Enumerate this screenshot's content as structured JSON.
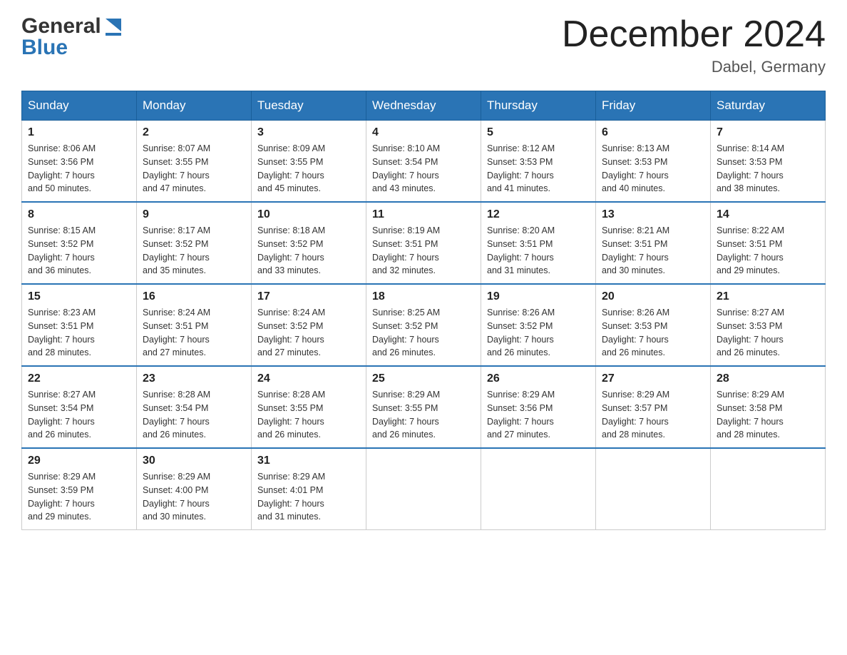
{
  "header": {
    "logo_general": "General",
    "logo_blue": "Blue",
    "month_title": "December 2024",
    "location": "Dabel, Germany"
  },
  "days_of_week": [
    "Sunday",
    "Monday",
    "Tuesday",
    "Wednesday",
    "Thursday",
    "Friday",
    "Saturday"
  ],
  "weeks": [
    [
      {
        "day": "1",
        "sunrise": "8:06 AM",
        "sunset": "3:56 PM",
        "daylight": "7 hours and 50 minutes."
      },
      {
        "day": "2",
        "sunrise": "8:07 AM",
        "sunset": "3:55 PM",
        "daylight": "7 hours and 47 minutes."
      },
      {
        "day": "3",
        "sunrise": "8:09 AM",
        "sunset": "3:55 PM",
        "daylight": "7 hours and 45 minutes."
      },
      {
        "day": "4",
        "sunrise": "8:10 AM",
        "sunset": "3:54 PM",
        "daylight": "7 hours and 43 minutes."
      },
      {
        "day": "5",
        "sunrise": "8:12 AM",
        "sunset": "3:53 PM",
        "daylight": "7 hours and 41 minutes."
      },
      {
        "day": "6",
        "sunrise": "8:13 AM",
        "sunset": "3:53 PM",
        "daylight": "7 hours and 40 minutes."
      },
      {
        "day": "7",
        "sunrise": "8:14 AM",
        "sunset": "3:53 PM",
        "daylight": "7 hours and 38 minutes."
      }
    ],
    [
      {
        "day": "8",
        "sunrise": "8:15 AM",
        "sunset": "3:52 PM",
        "daylight": "7 hours and 36 minutes."
      },
      {
        "day": "9",
        "sunrise": "8:17 AM",
        "sunset": "3:52 PM",
        "daylight": "7 hours and 35 minutes."
      },
      {
        "day": "10",
        "sunrise": "8:18 AM",
        "sunset": "3:52 PM",
        "daylight": "7 hours and 33 minutes."
      },
      {
        "day": "11",
        "sunrise": "8:19 AM",
        "sunset": "3:51 PM",
        "daylight": "7 hours and 32 minutes."
      },
      {
        "day": "12",
        "sunrise": "8:20 AM",
        "sunset": "3:51 PM",
        "daylight": "7 hours and 31 minutes."
      },
      {
        "day": "13",
        "sunrise": "8:21 AM",
        "sunset": "3:51 PM",
        "daylight": "7 hours and 30 minutes."
      },
      {
        "day": "14",
        "sunrise": "8:22 AM",
        "sunset": "3:51 PM",
        "daylight": "7 hours and 29 minutes."
      }
    ],
    [
      {
        "day": "15",
        "sunrise": "8:23 AM",
        "sunset": "3:51 PM",
        "daylight": "7 hours and 28 minutes."
      },
      {
        "day": "16",
        "sunrise": "8:24 AM",
        "sunset": "3:51 PM",
        "daylight": "7 hours and 27 minutes."
      },
      {
        "day": "17",
        "sunrise": "8:24 AM",
        "sunset": "3:52 PM",
        "daylight": "7 hours and 27 minutes."
      },
      {
        "day": "18",
        "sunrise": "8:25 AM",
        "sunset": "3:52 PM",
        "daylight": "7 hours and 26 minutes."
      },
      {
        "day": "19",
        "sunrise": "8:26 AM",
        "sunset": "3:52 PM",
        "daylight": "7 hours and 26 minutes."
      },
      {
        "day": "20",
        "sunrise": "8:26 AM",
        "sunset": "3:53 PM",
        "daylight": "7 hours and 26 minutes."
      },
      {
        "day": "21",
        "sunrise": "8:27 AM",
        "sunset": "3:53 PM",
        "daylight": "7 hours and 26 minutes."
      }
    ],
    [
      {
        "day": "22",
        "sunrise": "8:27 AM",
        "sunset": "3:54 PM",
        "daylight": "7 hours and 26 minutes."
      },
      {
        "day": "23",
        "sunrise": "8:28 AM",
        "sunset": "3:54 PM",
        "daylight": "7 hours and 26 minutes."
      },
      {
        "day": "24",
        "sunrise": "8:28 AM",
        "sunset": "3:55 PM",
        "daylight": "7 hours and 26 minutes."
      },
      {
        "day": "25",
        "sunrise": "8:29 AM",
        "sunset": "3:55 PM",
        "daylight": "7 hours and 26 minutes."
      },
      {
        "day": "26",
        "sunrise": "8:29 AM",
        "sunset": "3:56 PM",
        "daylight": "7 hours and 27 minutes."
      },
      {
        "day": "27",
        "sunrise": "8:29 AM",
        "sunset": "3:57 PM",
        "daylight": "7 hours and 28 minutes."
      },
      {
        "day": "28",
        "sunrise": "8:29 AM",
        "sunset": "3:58 PM",
        "daylight": "7 hours and 28 minutes."
      }
    ],
    [
      {
        "day": "29",
        "sunrise": "8:29 AM",
        "sunset": "3:59 PM",
        "daylight": "7 hours and 29 minutes."
      },
      {
        "day": "30",
        "sunrise": "8:29 AM",
        "sunset": "4:00 PM",
        "daylight": "7 hours and 30 minutes."
      },
      {
        "day": "31",
        "sunrise": "8:29 AM",
        "sunset": "4:01 PM",
        "daylight": "7 hours and 31 minutes."
      },
      null,
      null,
      null,
      null
    ]
  ],
  "labels": {
    "sunrise": "Sunrise:",
    "sunset": "Sunset:",
    "daylight": "Daylight:"
  }
}
